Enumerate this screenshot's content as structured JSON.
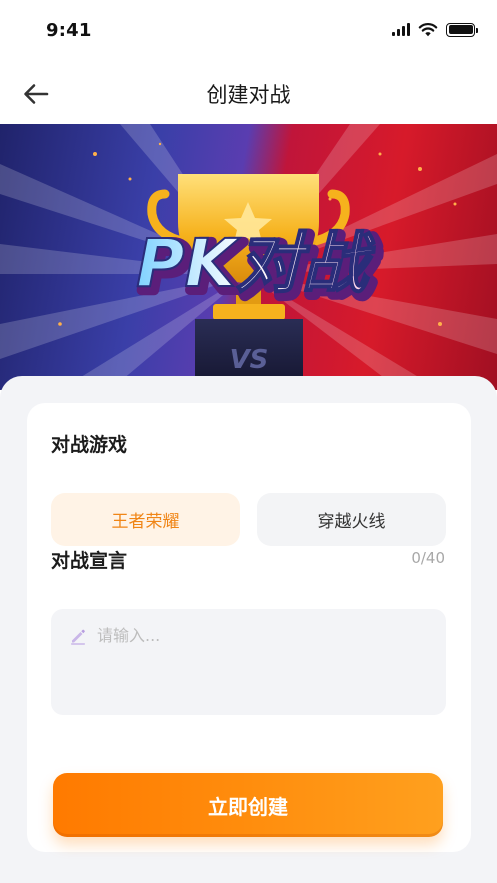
{
  "status_bar": {
    "time": "9:41",
    "icons": [
      "signal-icon",
      "wifi-icon",
      "battery-icon"
    ]
  },
  "nav": {
    "title": "创建对战",
    "back_icon": "arrow-left-icon"
  },
  "banner": {
    "title": "PK对战",
    "vs_label": "VS",
    "colors": {
      "left": "#3a3fa8",
      "right": "#d71a2a",
      "trophy": "#f6b21d"
    }
  },
  "form": {
    "game_section_title": "对战游戏",
    "game_options": [
      {
        "label": "王者荣耀",
        "selected": true
      },
      {
        "label": "穿越火线",
        "selected": false
      }
    ],
    "declaration_title": "对战宣言",
    "declaration_counter": "0/40",
    "declaration_placeholder": "请输入...",
    "declaration_value": "",
    "submit_label": "立即创建"
  },
  "colors": {
    "accent": "#ff8a0a",
    "selected_bg": "#fff3e6",
    "selected_text": "#f08516",
    "sheet_bg": "#f3f4f7"
  }
}
